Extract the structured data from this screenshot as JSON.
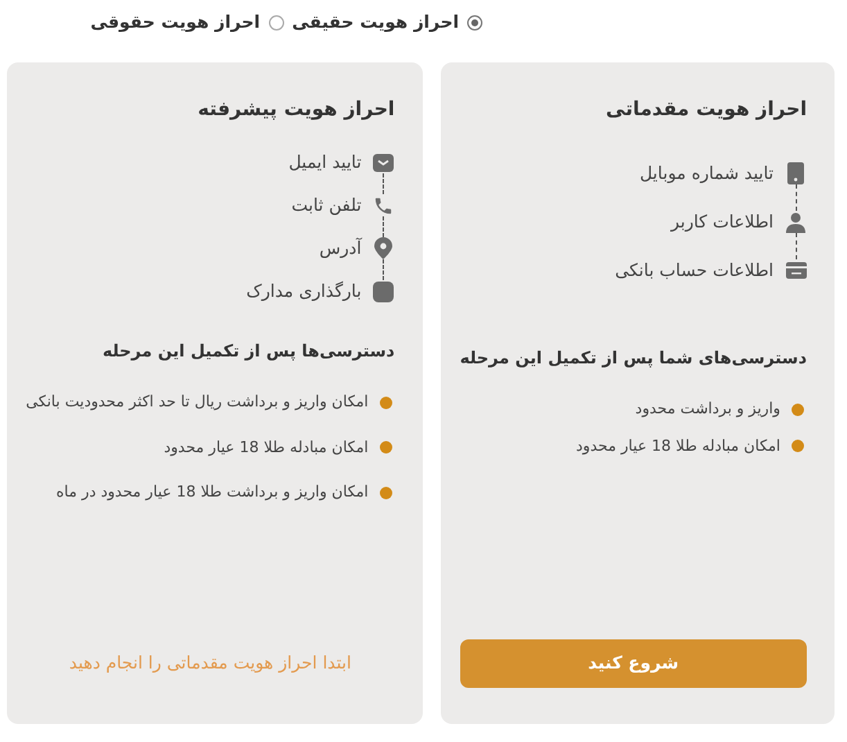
{
  "identity_type": [
    {
      "label": "احراز هویت حقیقی",
      "selected": true
    },
    {
      "label": "احراز هویت حقوقی",
      "selected": false
    }
  ],
  "cards": [
    {
      "title": "احراز هویت مقدماتی",
      "steps": [
        {
          "kind": "mobile",
          "label": "تایید شماره موبایل"
        },
        {
          "kind": "user",
          "label": "اطلاعات کاربر"
        },
        {
          "kind": "card",
          "label": "اطلاعات حساب بانکی"
        }
      ],
      "access_title": "دسترسی‌های شما پس از تکمیل این مرحله",
      "access": [
        "واریز و برداشت محدود",
        "امکان مبادله طلا 18 عیار محدود"
      ],
      "action": {
        "kind": "button",
        "label": "شروع کنید"
      }
    },
    {
      "title": "احراز هویت پیشرفته",
      "steps": [
        {
          "kind": "mail",
          "label": "تایید ایمیل"
        },
        {
          "kind": "phone",
          "label": "تلفن ثابت"
        },
        {
          "kind": "pin",
          "label": "آدرس"
        },
        {
          "kind": "doc",
          "label": "بارگذاری مدارک"
        }
      ],
      "access_title": "دسترسی‌ها پس از تکمیل این مرحله",
      "access": [
        "امکان واریز و برداشت ریال تا حد اکثر محدودیت بانکی",
        "امکان مبادله طلا 18 عیار محدود",
        "امکان واریز و برداشت طلا 18 عیار محدود در ماه"
      ],
      "action": {
        "kind": "notice",
        "label": "ابتدا احراز هویت مقدماتی را انجام دهید"
      }
    }
  ]
}
